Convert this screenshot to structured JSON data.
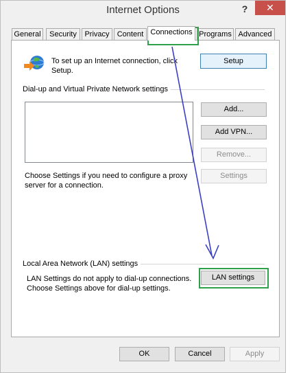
{
  "window": {
    "title": "Internet Options",
    "help": "?",
    "close": "✕"
  },
  "tabs": [
    "General",
    "Security",
    "Privacy",
    "Content",
    "Connections",
    "Programs",
    "Advanced"
  ],
  "setup": {
    "text": "To set up an Internet connection, click Setup.",
    "button": "Setup"
  },
  "dialup": {
    "group_label": "Dial-up and Virtual Private Network settings",
    "add": "Add...",
    "add_vpn": "Add VPN...",
    "remove": "Remove...",
    "settings_text": "Choose Settings if you need to configure a proxy server for a connection.",
    "settings_button": "Settings"
  },
  "lan": {
    "group_label": "Local Area Network (LAN) settings",
    "text": "LAN Settings do not apply to dial-up connections. Choose Settings above for dial-up settings.",
    "button": "LAN settings"
  },
  "footer": {
    "ok": "OK",
    "cancel": "Cancel",
    "apply": "Apply"
  },
  "colors": {
    "highlight": "#2ea04a",
    "arrow": "#3a3fc4",
    "close": "#c7504b"
  }
}
